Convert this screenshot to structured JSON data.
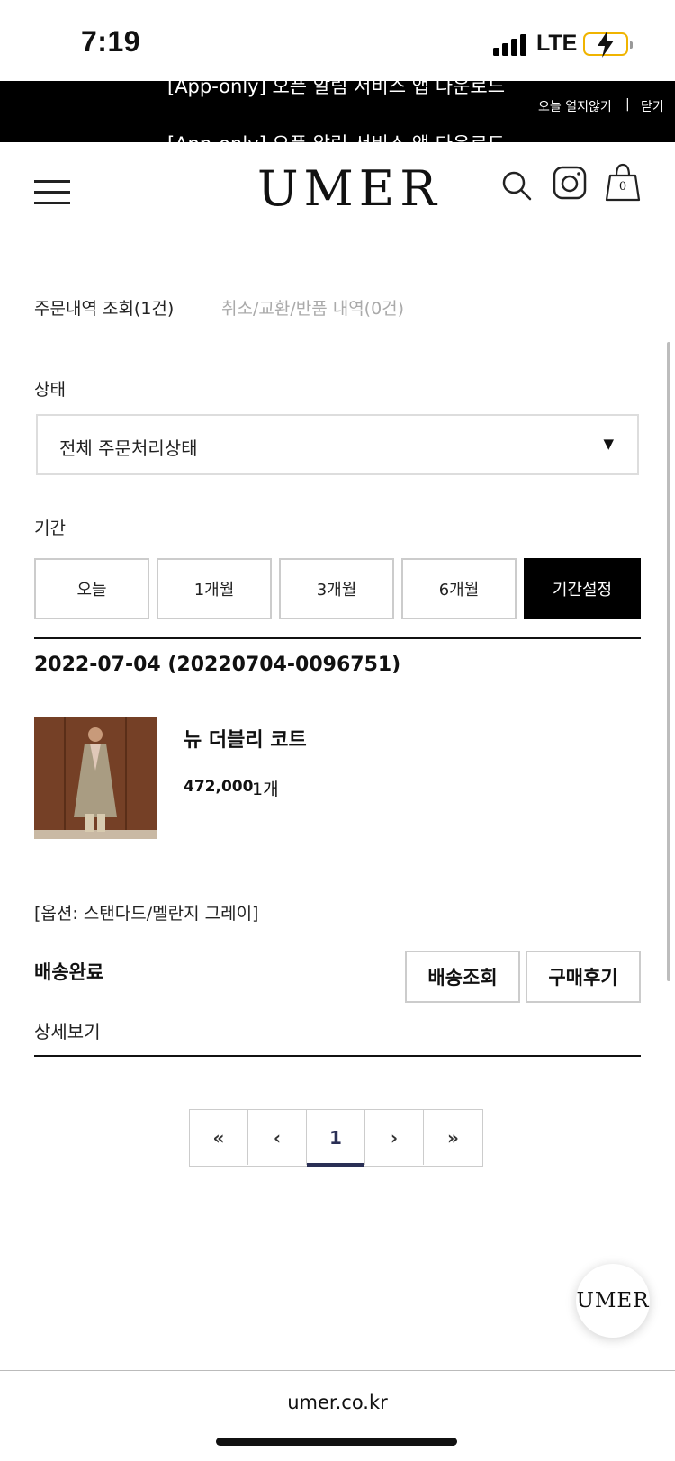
{
  "status_bar": {
    "time": "7:19",
    "network": "LTE"
  },
  "promo": {
    "line1": "[App-only] 오픈 알림 서비스 앱 다운로드",
    "line2": "[App-only] 오픈 알림 서비스 앱 다운로드",
    "hide_today": "오늘 열지않기",
    "separator": "|",
    "close": "닫기"
  },
  "header": {
    "logo": "UMER",
    "cart_count": "0"
  },
  "tabs": {
    "orders": "주문내역 조회(1건)",
    "returns": "취소/교환/반품 내역(0건)"
  },
  "filter": {
    "status_label": "상태",
    "status_value": "전체 주문처리상태",
    "period_label": "기간",
    "periods": [
      "오늘",
      "1개월",
      "3개월",
      "6개월",
      "기간설정"
    ],
    "active_period": "기간설정"
  },
  "order": {
    "date": "2022-07-04 (20220704-0096751)",
    "product_name": "뉴 더블리 코트",
    "price": "472,000",
    "quantity": "1개",
    "option": "[옵션: 스탠다드/멜란지 그레이]",
    "shipping_status": "배송완료",
    "track_button": "배송조회",
    "review_button": "구매후기",
    "detail_link": "상세보기"
  },
  "pagination": {
    "first": "«",
    "prev": "‹",
    "current": "1",
    "next": "›",
    "last": "»"
  },
  "fab": {
    "label": "UMER"
  },
  "browser": {
    "url": "umer.co.kr"
  },
  "colors": {
    "banner_bg": "#000000",
    "active_button": "#000000",
    "pager_accent": "#2a2f55",
    "battery": "#f0b400"
  }
}
